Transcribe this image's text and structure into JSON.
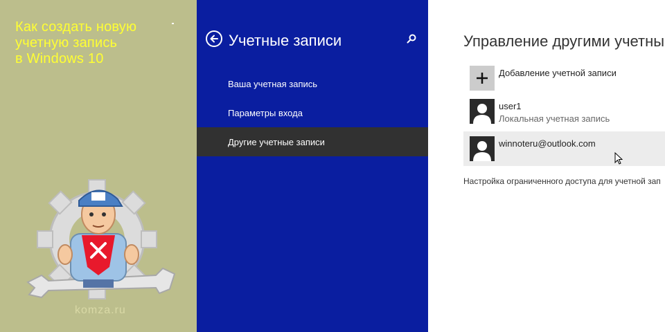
{
  "promo": {
    "title_line1": "Как создать новую",
    "title_line2": "учетную запись",
    "title_line3": "в Windows 10",
    "site": "komza.ru"
  },
  "nav": {
    "title": "Учетные записи",
    "items": [
      {
        "label": "Ваша учетная запись",
        "selected": false
      },
      {
        "label": "Параметры входа",
        "selected": false
      },
      {
        "label": "Другие учетные записи",
        "selected": true
      }
    ]
  },
  "content": {
    "title": "Управление другими учетным",
    "add_account_label": "Добавление учетной записи",
    "accounts": [
      {
        "name": "user1",
        "type": "Локальная учетная запись"
      },
      {
        "name": "winnoteru@outlook.com",
        "type": ""
      }
    ],
    "restricted_access_note": "Настройка ограниченного доступа для учетной зап"
  },
  "colors": {
    "promo_bg": "#bcbe8c",
    "promo_title": "#ffff33",
    "nav_bg": "#0a1ea0",
    "nav_selected": "#313131",
    "content_bg": "#ffffff",
    "row_hover": "#ececec"
  },
  "icons": [
    "back-arrow-icon",
    "search-icon",
    "plus-icon",
    "user-avatar-icon",
    "mouse-cursor-icon",
    "gear-icon",
    "wrench-icon"
  ]
}
